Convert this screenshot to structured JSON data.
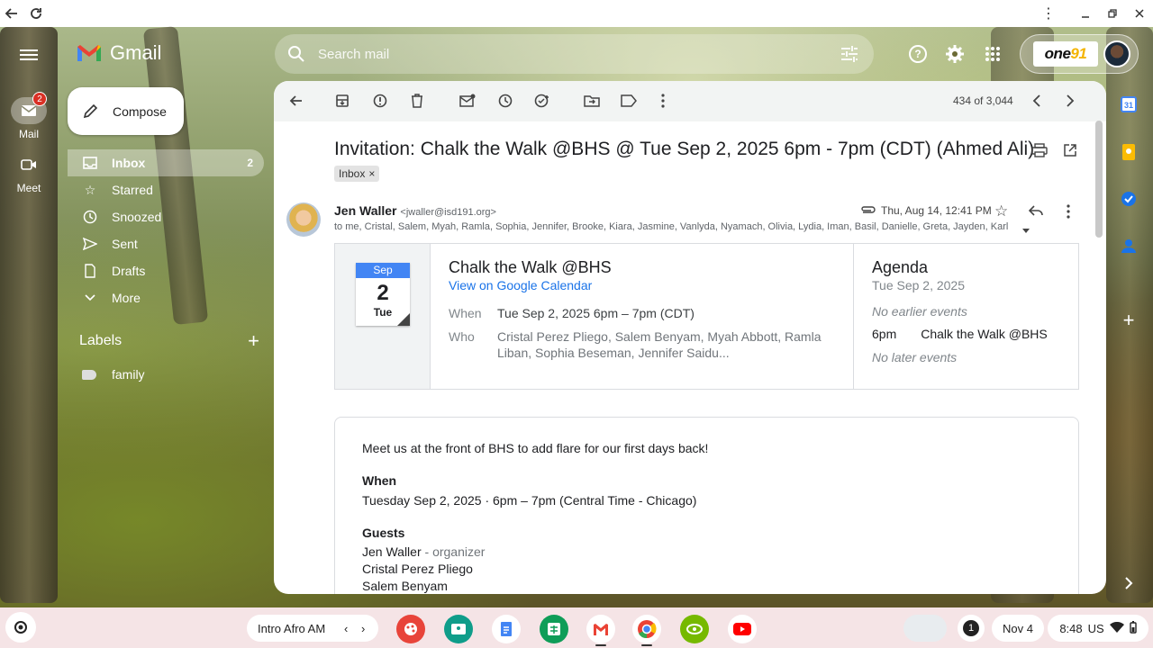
{
  "browser": {
    "back_icon": "arrow-left-icon",
    "reload_icon": "reload-icon"
  },
  "gmail": {
    "brand": "Gmail",
    "search": {
      "placeholder": "Search mail"
    },
    "rail": [
      {
        "label": "Mail",
        "badge": "2"
      },
      {
        "label": "Meet"
      }
    ],
    "compose_label": "Compose",
    "nav": [
      {
        "label": "Inbox",
        "count": "2",
        "icon": "inbox-icon"
      },
      {
        "label": "Starred",
        "icon": "star-icon"
      },
      {
        "label": "Snoozed",
        "icon": "clock-icon"
      },
      {
        "label": "Sent",
        "icon": "send-icon"
      },
      {
        "label": "Drafts",
        "icon": "draft-icon"
      },
      {
        "label": "More",
        "icon": "chevron-down-icon"
      }
    ],
    "labels_heading": "Labels",
    "labels": [
      {
        "label": "family"
      }
    ],
    "account_logo": {
      "text": "one",
      "highlight": "91"
    }
  },
  "toolbar": {
    "pager": "434 of 3,044"
  },
  "email": {
    "subject": "Invitation: Chalk the Walk @BHS @ Tue Sep 2, 2025 6pm - 7pm (CDT) (Ahmed Ali)",
    "tag": "Inbox",
    "tag_close": "×",
    "sender_name": "Jen Waller",
    "sender_email": "<jwaller@isd191.org>",
    "date": "Thu, Aug 14, 12:41 PM",
    "recipients": "to me, Cristal, Salem, Myah, Ramla, Sophia, Jennifer, Brooke, Kiara, Jasmine, Vanlyda, Nyamach, Olivia, Lydia, Iman, Basil, Danielle, Greta, Jayden, Karl",
    "invite": {
      "month": "Sep",
      "day": "2",
      "weekday": "Tue",
      "title": "Chalk the Walk @BHS",
      "link": "View on Google Calendar",
      "when_label": "When",
      "when_value": "Tue Sep 2, 2025 6pm – 7pm (CDT)",
      "who_label": "Who",
      "who_value": "Cristal Perez Pliego, Salem Benyam, Myah Abbott, Ramla Liban, Sophia Beseman, Jennifer Saidu..."
    },
    "agenda": {
      "title": "Agenda",
      "date": "Tue Sep 2, 2025",
      "before": "No earlier events",
      "event_time": "6pm",
      "event_name": "Chalk the Walk @BHS",
      "after": "No later events"
    },
    "body": {
      "intro": "Meet us at the front of BHS to add flare for our first days back!",
      "when_heading": "When",
      "when_text": "Tuesday Sep 2, 2025 · 6pm – 7pm (Central Time - Chicago)",
      "guests_heading": "Guests",
      "guest1": "Jen Waller",
      "guest1_role": "- organizer",
      "guest2": "Cristal Perez Pliego",
      "guest3": "Salem Benyam"
    }
  },
  "shelf": {
    "desk_name": "Intro Afro AM",
    "notification_count": "1",
    "date": "Nov 4",
    "time": "8:48",
    "locale": "US"
  },
  "colors": {
    "accent_blue": "#1a73e8",
    "badge_red": "#d93025",
    "calendar_blue": "#4285f4"
  }
}
